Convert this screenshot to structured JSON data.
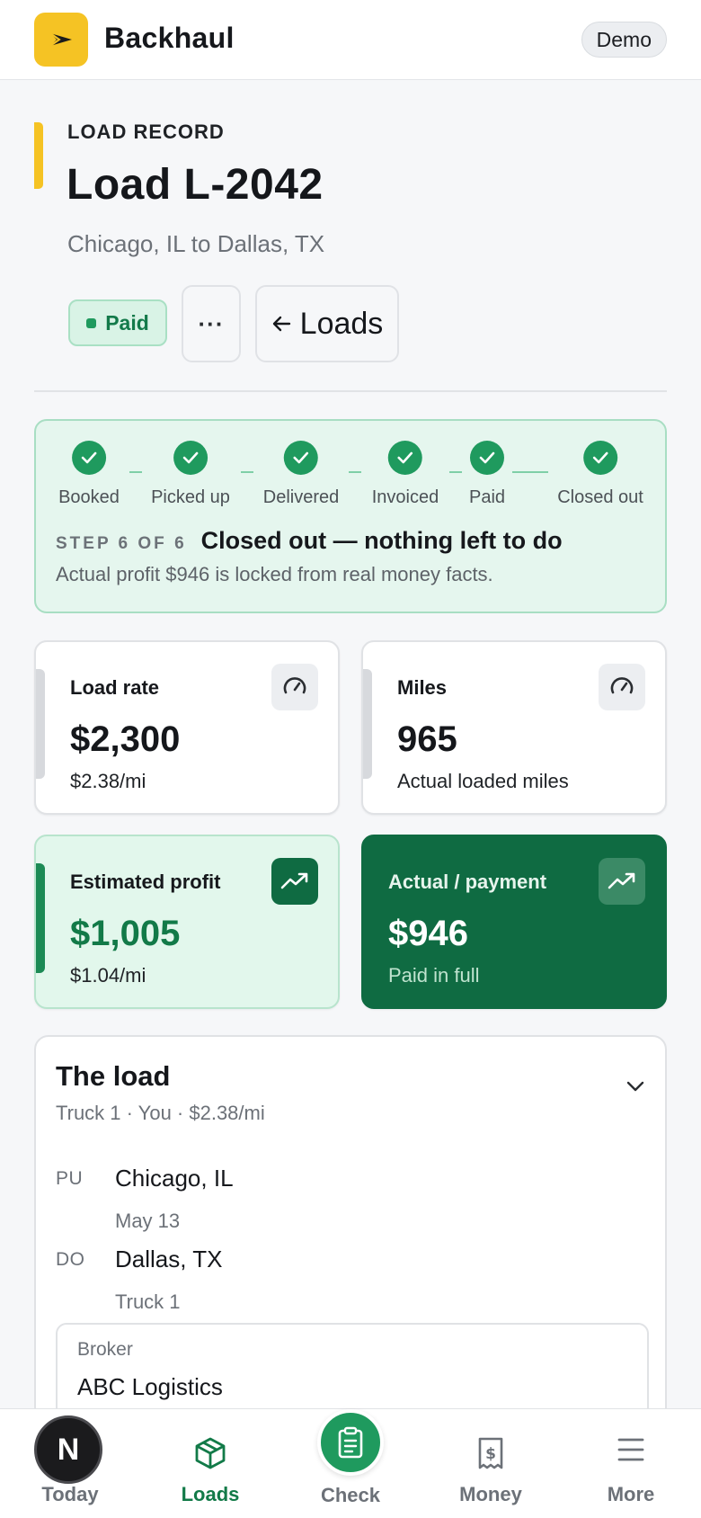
{
  "app": {
    "brand": "Backhaul",
    "mode_badge": "Demo"
  },
  "record": {
    "eyebrow": "LOAD RECORD",
    "title": "Load L-2042",
    "route": "Chicago, IL to Dallas, TX",
    "status": "Paid",
    "more_label": "···",
    "back_label": "Loads"
  },
  "progress": {
    "steps": [
      {
        "label": "Booked",
        "done": true
      },
      {
        "label": "Picked up",
        "done": true
      },
      {
        "label": "Delivered",
        "done": true
      },
      {
        "label": "Invoiced",
        "done": true
      },
      {
        "label": "Paid",
        "done": true
      },
      {
        "label": "Closed out",
        "done": true
      }
    ],
    "step_count": "STEP 6 OF 6",
    "step_title": "Closed out — nothing left to do",
    "step_note": "Actual profit $946 is locked from real money facts."
  },
  "metrics": {
    "load_rate": {
      "label": "Load rate",
      "value": "$2,300",
      "sub": "$2.38/mi",
      "icon": "gauge-icon"
    },
    "miles": {
      "label": "Miles",
      "value": "965",
      "sub": "Actual loaded miles",
      "icon": "gauge-icon"
    },
    "estimated_profit": {
      "label": "Estimated profit",
      "value": "$1,005",
      "sub": "$1.04/mi",
      "icon": "trend-up-icon"
    },
    "actual_payment": {
      "label": "Actual / payment",
      "value": "$946",
      "sub": "Paid in full",
      "icon": "trend-up-icon"
    }
  },
  "load_details": {
    "title": "The load",
    "subtitle": "Truck 1 · You · $2.38/mi",
    "pickup": {
      "code": "PU",
      "place": "Chicago, IL",
      "detail": "May 13"
    },
    "dropoff": {
      "code": "DO",
      "place": "Dallas, TX",
      "detail": "Truck 1"
    },
    "broker": {
      "label": "Broker",
      "name": "ABC Logistics"
    }
  },
  "nav": {
    "avatar_letter": "N",
    "items": [
      {
        "label": "Today",
        "icon": "home-icon",
        "active": false
      },
      {
        "label": "Loads",
        "icon": "box-icon",
        "active": true
      },
      {
        "label": "Check",
        "icon": "clipboard-icon",
        "active": false
      },
      {
        "label": "Money",
        "icon": "receipt-dollar-icon",
        "active": false
      },
      {
        "label": "More",
        "icon": "menu-icon",
        "active": false
      }
    ]
  },
  "colors": {
    "accent_yellow": "#f5c324",
    "success_green": "#1f9a5e",
    "dark_green": "#0f6b42"
  }
}
